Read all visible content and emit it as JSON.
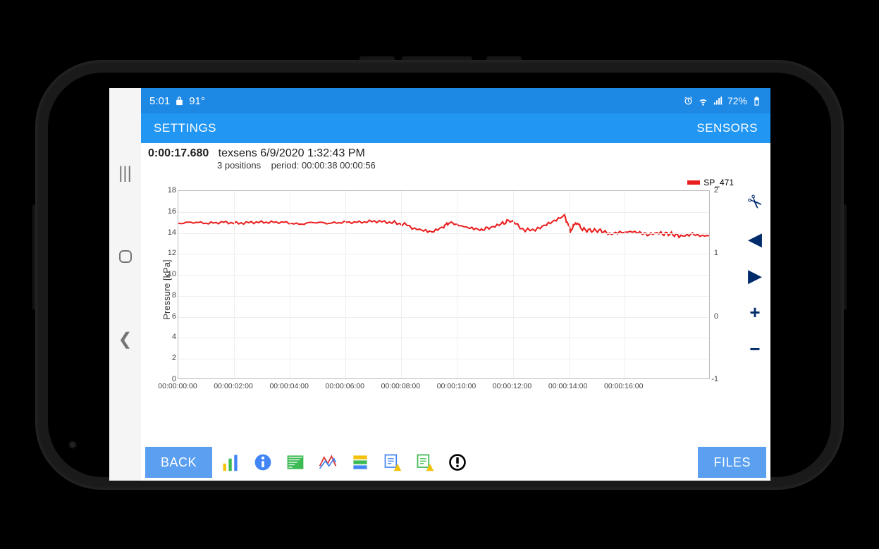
{
  "status_bar": {
    "time": "5:01",
    "temp": "91°",
    "battery_text": "72%"
  },
  "app_bar": {
    "left": "SETTINGS",
    "right": "SENSORS"
  },
  "header": {
    "elapsed": "0:00:17.680",
    "title": "texsens 6/9/2020 1:32:43 PM",
    "positions": "3 positions",
    "period": "period: 00:00:38 00:00:56"
  },
  "legend": {
    "series": "SP_471"
  },
  "bottom": {
    "back": "BACK",
    "files": "FILES"
  },
  "chart_data": {
    "type": "line",
    "title": "SP_471",
    "ylabel": "Pressure [kPa]",
    "xlabel": "",
    "ylim": [
      0,
      18
    ],
    "y2lim": [
      -1,
      2
    ],
    "y_ticks": [
      0,
      2,
      4,
      6,
      8,
      10,
      12,
      14,
      16,
      18
    ],
    "y2_ticks": [
      -1,
      0,
      1,
      2
    ],
    "x_ticks": [
      "00:00:00:00",
      "00:00:02:00",
      "00:00:04:00",
      "00:00:06:00",
      "00:00:08:00",
      "00:00:10:00",
      "00:00:12:00",
      "00:00:14:00",
      "00:00:16:00"
    ],
    "series": [
      {
        "name": "SP_471",
        "color": "#e91e1e",
        "x": [
          0,
          0.5,
          1,
          1.5,
          2,
          2.5,
          3,
          3.5,
          4,
          4.5,
          5,
          5.5,
          6,
          6.5,
          7,
          7.5,
          8,
          8.4,
          8.8,
          9,
          9.3,
          9.6,
          10,
          10.3,
          10.7,
          11,
          11.5,
          12,
          12.4,
          12.8,
          13,
          13.2,
          13.4,
          13.7,
          14,
          14.3,
          14.7,
          15,
          15.3,
          15.6,
          16,
          16.3,
          16.6,
          17,
          17.3,
          17.6
        ],
        "y": [
          14.9,
          15.0,
          14.9,
          15.0,
          14.9,
          15.0,
          15.0,
          15.0,
          14.8,
          15.0,
          14.9,
          15.0,
          15.0,
          15.1,
          15.0,
          14.8,
          14.2,
          14.0,
          14.6,
          15.0,
          14.7,
          14.5,
          14.2,
          14.5,
          14.8,
          15.2,
          14.2,
          14.4,
          15.0,
          15.7,
          14.2,
          15.0,
          14.3,
          14.2,
          14.2,
          13.9,
          14.0,
          14.1,
          14.0,
          13.8,
          13.9,
          13.9,
          13.7,
          13.9,
          13.7,
          13.7
        ]
      }
    ]
  }
}
